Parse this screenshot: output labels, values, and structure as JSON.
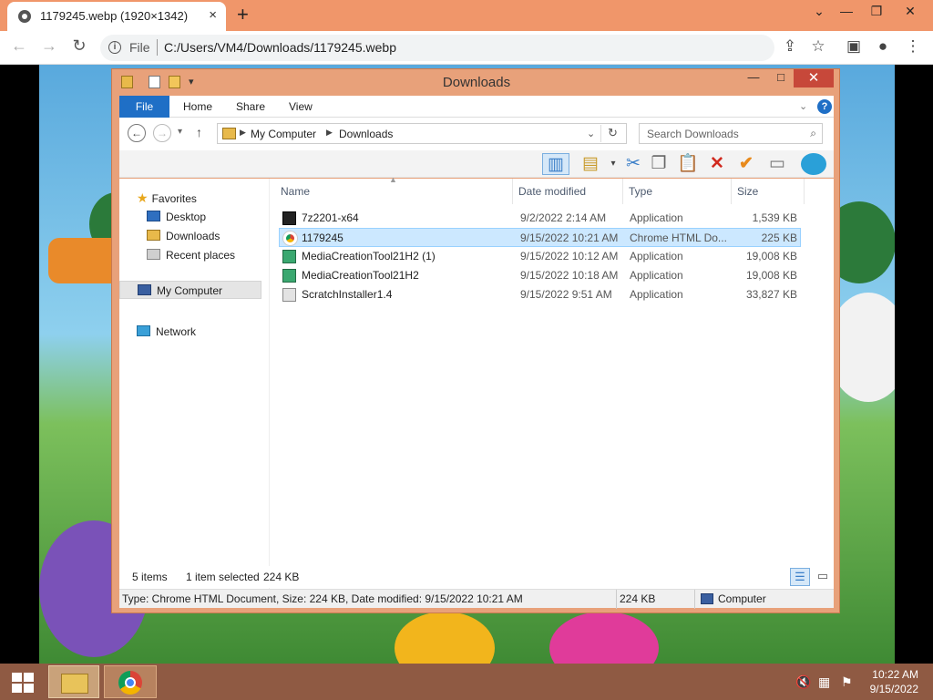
{
  "browser": {
    "tab_title": "1179245.webp (1920×1342)",
    "tab_close": "×",
    "new_tab": "+",
    "scheme": "File",
    "url": "C:/Users/VM4/Downloads/1179245.webp"
  },
  "explorer": {
    "title": "Downloads",
    "ribbon_tabs": [
      "File",
      "Home",
      "Share",
      "View"
    ],
    "breadcrumb": [
      "My Computer",
      "Downloads"
    ],
    "search_placeholder": "Search Downloads",
    "nav": {
      "favorites": "Favorites",
      "desktop": "Desktop",
      "downloads": "Downloads",
      "recent": "Recent places",
      "computer": "My Computer",
      "network": "Network"
    },
    "columns": {
      "name": "Name",
      "date": "Date modified",
      "type": "Type",
      "size": "Size"
    },
    "files": [
      {
        "name": "7z2201-x64",
        "date": "9/2/2022 2:14 AM",
        "type": "Application",
        "size": "1,539 KB",
        "icon": "7zip-icon"
      },
      {
        "name": "1179245",
        "date": "9/15/2022 10:21 AM",
        "type": "Chrome HTML Do...",
        "size": "225 KB",
        "icon": "chrome-file-icon",
        "selected": true
      },
      {
        "name": "MediaCreationTool21H2 (1)",
        "date": "9/15/2022 10:12 AM",
        "type": "Application",
        "size": "19,008 KB",
        "icon": "installer-icon"
      },
      {
        "name": "MediaCreationTool21H2",
        "date": "9/15/2022 10:18 AM",
        "type": "Application",
        "size": "19,008 KB",
        "icon": "installer-icon"
      },
      {
        "name": "ScratchInstaller1.4",
        "date": "9/15/2022 9:51 AM",
        "type": "Application",
        "size": "33,827 KB",
        "icon": "scratch-icon"
      }
    ],
    "status_items": "5 items",
    "status_selected": "1 item selected",
    "status_size": "224 KB",
    "details_text": "Type: Chrome HTML Document, Size: 224 KB, Date modified: 9/15/2022 10:21 AM",
    "details_size": "224 KB",
    "details_location": "Computer"
  },
  "taskbar": {
    "time": "10:22 AM",
    "date": "9/15/2022"
  },
  "colors": {
    "chrome_frame": "#f0966a",
    "explorer_frame": "#e8a17a",
    "taskbar": "#8f5a43",
    "selection": "#cce8ff",
    "ribbon_file": "#1f6fc6"
  }
}
